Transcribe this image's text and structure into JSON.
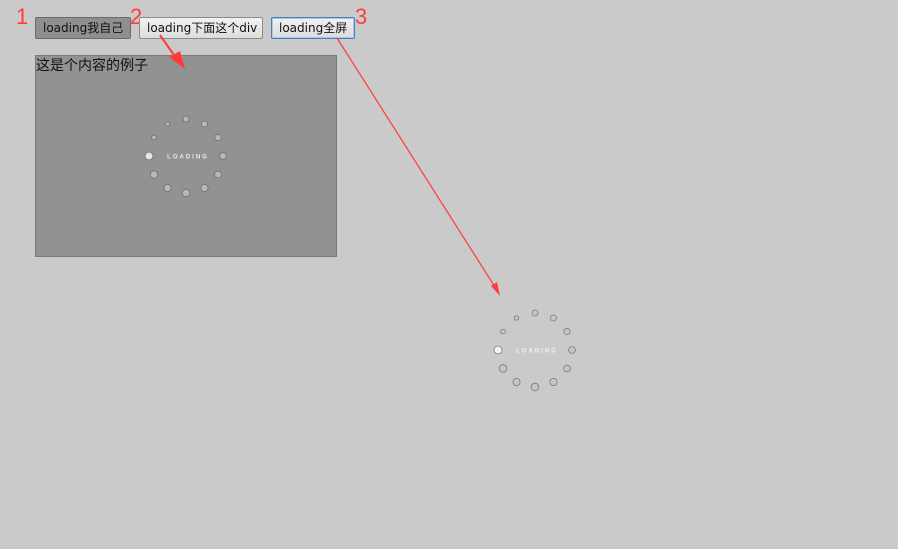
{
  "annotations": {
    "num1": "1",
    "num2": "2",
    "num3": "3"
  },
  "buttons": {
    "loading_self": "loading我自己",
    "loading_div": "loading下面这个div",
    "loading_fullscreen": "loading全屏"
  },
  "content": {
    "text": "这是个内容的例子"
  },
  "spinner": {
    "label": "LOADING"
  },
  "colors": {
    "background": "#cacaca",
    "content_box": "#929292",
    "annotation_red": "#ff3b3b"
  }
}
